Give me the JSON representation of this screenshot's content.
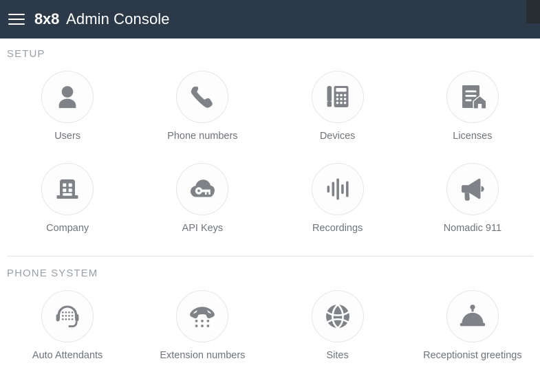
{
  "header": {
    "menu_icon": "hamburger-menu-icon",
    "brand": "8x8",
    "title": "Admin Console",
    "background_color": "#2b3949",
    "text_color": "#ffffff"
  },
  "theme": {
    "page_background": "#ffffff",
    "icon_color": "#7f8387",
    "label_color": "#6f7479",
    "section_title_color": "#9aa0a6",
    "circle_border_color": "#e6e6e6",
    "divider_color": "#e3e3e3"
  },
  "sections": [
    {
      "id": "setup",
      "title": "SETUP",
      "has_divider_above": false,
      "tiles": [
        {
          "id": "users",
          "label": "Users",
          "icon": "user-person-icon"
        },
        {
          "id": "phone-numbers",
          "label": "Phone numbers",
          "icon": "phone-handset-icon"
        },
        {
          "id": "devices",
          "label": "Devices",
          "icon": "desk-phone-icon"
        },
        {
          "id": "licenses",
          "label": "Licenses",
          "icon": "document-house-icon"
        },
        {
          "id": "company",
          "label": "Company",
          "icon": "office-building-icon"
        },
        {
          "id": "api-keys",
          "label": "API Keys",
          "icon": "cloud-key-icon"
        },
        {
          "id": "recordings",
          "label": "Recordings",
          "icon": "audio-waveform-icon"
        },
        {
          "id": "nomadic-911",
          "label": "Nomadic 911",
          "icon": "megaphone-icon"
        }
      ]
    },
    {
      "id": "phone-system",
      "title": "PHONE SYSTEM",
      "has_divider_above": true,
      "tiles": [
        {
          "id": "auto-attendants",
          "label": "Auto Attendants",
          "icon": "headset-keypad-icon"
        },
        {
          "id": "extension-numbers",
          "label": "Extension numbers",
          "icon": "handset-dots-icon"
        },
        {
          "id": "sites",
          "label": "Sites",
          "icon": "globe-icon"
        },
        {
          "id": "receptionist-greetings",
          "label": "Receptionist greetings",
          "icon": "service-bell-icon"
        }
      ]
    }
  ]
}
